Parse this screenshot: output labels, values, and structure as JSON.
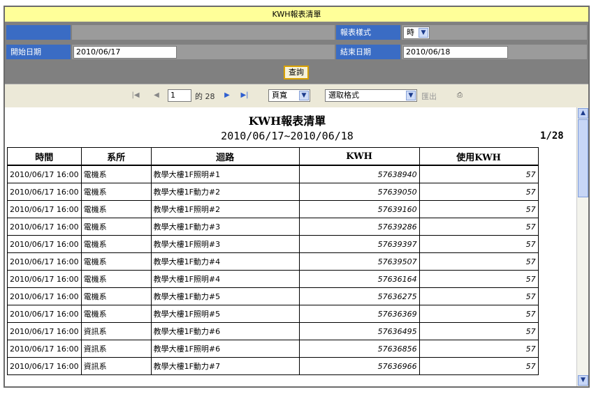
{
  "header": {
    "title": "KWH報表清單"
  },
  "filters": {
    "report_style_label": "報表樣式",
    "report_style_value": "時",
    "start_date_label": "開始日期",
    "start_date_value": "2010/06/17",
    "end_date_label": "結束日期",
    "end_date_value": "2010/06/18",
    "query_label": "查詢"
  },
  "toolbar": {
    "page_input": "1",
    "page_of": "的 28",
    "view_select": "頁寬",
    "format_select": "選取格式",
    "export_label": "匯出",
    "icons": [
      "first-page-icon",
      "prev-page-icon",
      "next-page-icon",
      "last-page-icon",
      "print-icon"
    ]
  },
  "report": {
    "title": "KWH報表清單",
    "range": "2010/06/17~2010/06/18",
    "page": "1/28",
    "columns": [
      "時間",
      "系所",
      "迴路",
      "KWH",
      "使用KWH"
    ],
    "rows": [
      [
        "2010/06/17 16:00",
        "電機系",
        "教學大樓1F照明#1",
        "57638940",
        "57"
      ],
      [
        "2010/06/17 16:00",
        "電機系",
        "教學大樓1F動力#2",
        "57639050",
        "57"
      ],
      [
        "2010/06/17 16:00",
        "電機系",
        "教學大樓1F照明#2",
        "57639160",
        "57"
      ],
      [
        "2010/06/17 16:00",
        "電機系",
        "教學大樓1F動力#3",
        "57639286",
        "57"
      ],
      [
        "2010/06/17 16:00",
        "電機系",
        "教學大樓1F照明#3",
        "57639397",
        "57"
      ],
      [
        "2010/06/17 16:00",
        "電機系",
        "教學大樓1F動力#4",
        "57639507",
        "57"
      ],
      [
        "2010/06/17 16:00",
        "電機系",
        "教學大樓1F照明#4",
        "57636164",
        "57"
      ],
      [
        "2010/06/17 16:00",
        "電機系",
        "教學大樓1F動力#5",
        "57636275",
        "57"
      ],
      [
        "2010/06/17 16:00",
        "電機系",
        "教學大樓1F照明#5",
        "57636369",
        "57"
      ],
      [
        "2010/06/17 16:00",
        "資訊系",
        "教學大樓1F動力#6",
        "57636495",
        "57"
      ],
      [
        "2010/06/17 16:00",
        "資訊系",
        "教學大樓1F照明#6",
        "57636856",
        "57"
      ],
      [
        "2010/06/17 16:00",
        "資訊系",
        "教學大樓1F動力#7",
        "57636966",
        "57"
      ]
    ]
  },
  "colors": {
    "title_bar": "#ffff99",
    "label_blue": "#3a6cc4",
    "panel_grey": "#808080",
    "toolbar_bg": "#ece9d8"
  }
}
